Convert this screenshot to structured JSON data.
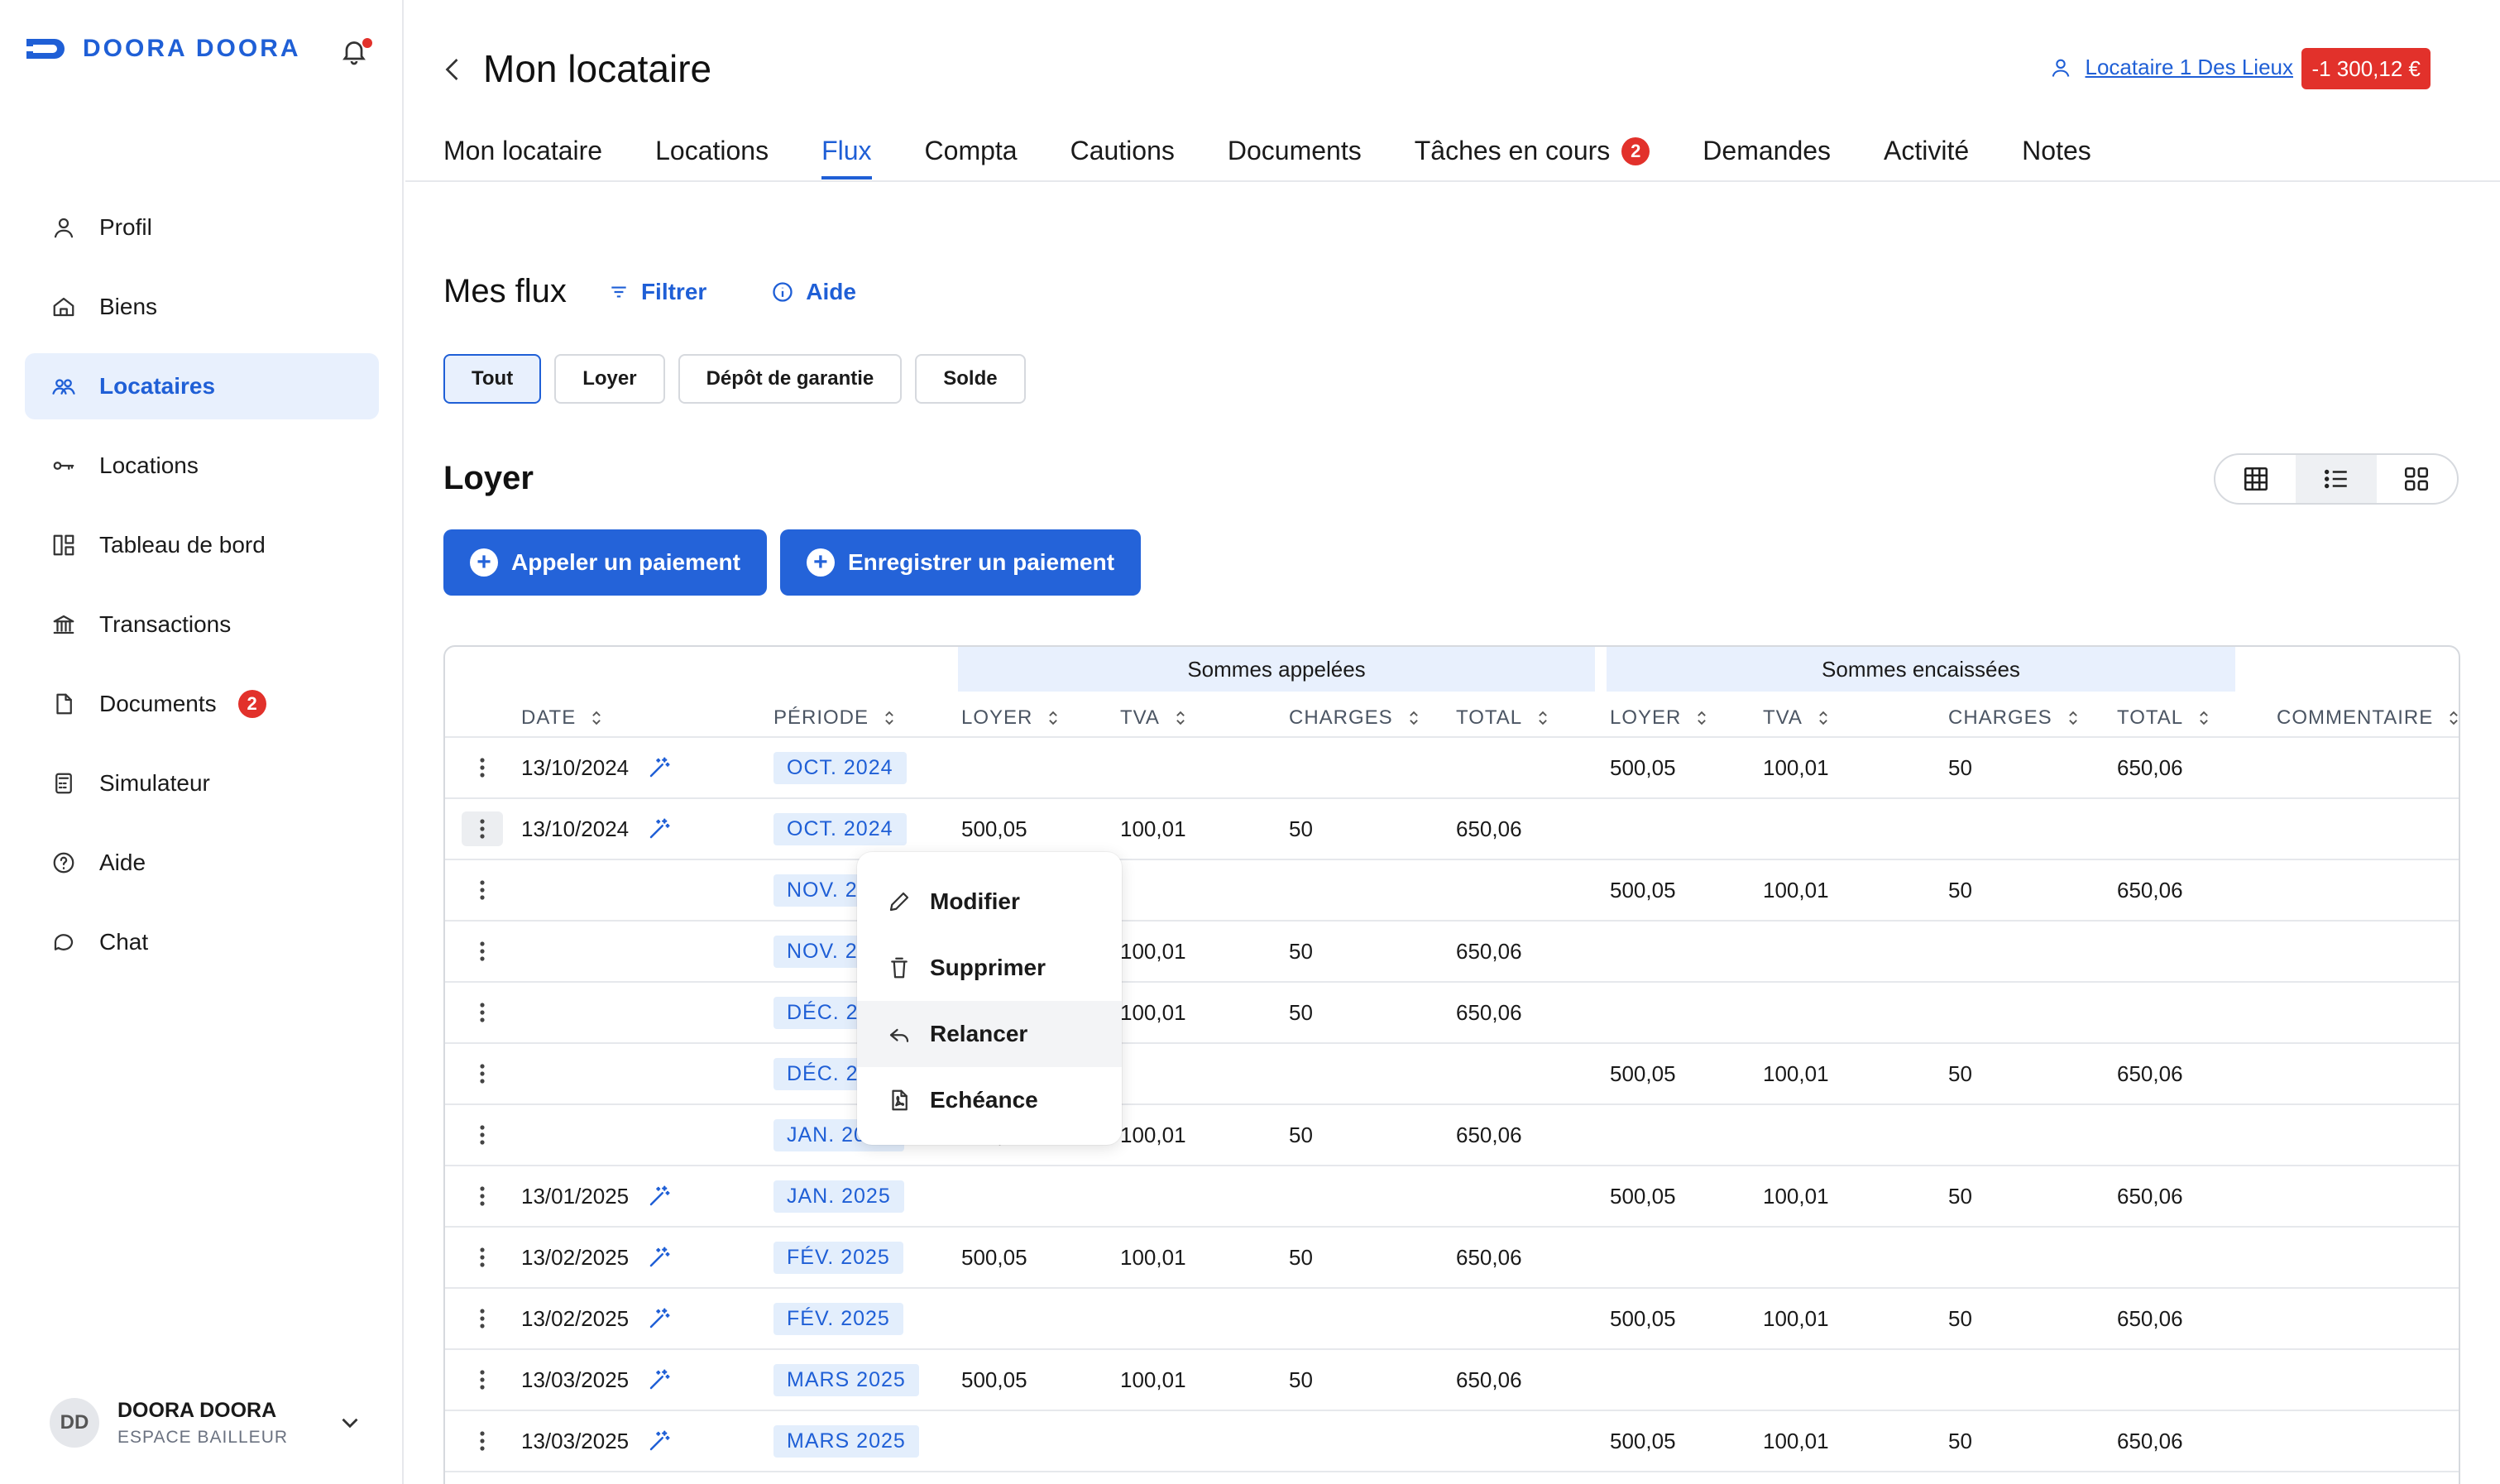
{
  "app": {
    "brand": "DOORA DOORA"
  },
  "sidebar": {
    "items": [
      {
        "label": "Profil",
        "icon": "user-icon"
      },
      {
        "label": "Biens",
        "icon": "home-icon"
      },
      {
        "label": "Locataires",
        "icon": "users-icon",
        "active": true
      },
      {
        "label": "Locations",
        "icon": "key-icon"
      },
      {
        "label": "Tableau de bord",
        "icon": "dashboard-icon"
      },
      {
        "label": "Transactions",
        "icon": "bank-icon"
      },
      {
        "label": "Documents",
        "icon": "document-icon",
        "badge": "2"
      },
      {
        "label": "Simulateur",
        "icon": "calculator-icon"
      },
      {
        "label": "Aide",
        "icon": "help-icon"
      },
      {
        "label": "Chat",
        "icon": "chat-icon"
      }
    ],
    "user": {
      "initials": "DD",
      "name": "DOORA DOORA",
      "role": "ESPACE BAILLEUR"
    }
  },
  "header": {
    "title": "Mon locataire",
    "tenant_link": "Locataire 1 Des Lieux",
    "balance": "-1 300,12 €"
  },
  "tabs": [
    {
      "label": "Mon locataire"
    },
    {
      "label": "Locations"
    },
    {
      "label": "Flux",
      "active": true
    },
    {
      "label": "Compta"
    },
    {
      "label": "Cautions"
    },
    {
      "label": "Documents"
    },
    {
      "label": "Tâches en cours",
      "badge": "2"
    },
    {
      "label": "Demandes"
    },
    {
      "label": "Activité"
    },
    {
      "label": "Notes"
    }
  ],
  "flux": {
    "title": "Mes flux",
    "filter_label": "Filtrer",
    "help_label": "Aide",
    "chips": [
      "Tout",
      "Loyer",
      "Dépôt de garantie",
      "Solde"
    ],
    "active_chip": "Tout"
  },
  "loyer": {
    "title": "Loyer",
    "call_payment": "Appeler un paiement",
    "record_payment": "Enregistrer un paiement",
    "view_mode": "list"
  },
  "table": {
    "group_called": "Sommes appelées",
    "group_collected": "Sommes encaissées",
    "headers": {
      "date": "DATE",
      "periode": "PÉRIODE",
      "c_loyer": "LOYER",
      "c_tva": "TVA",
      "c_charges": "CHARGES",
      "c_total": "TOTAL",
      "e_loyer": "LOYER",
      "e_tva": "TVA",
      "e_charges": "CHARGES",
      "e_total": "TOTAL",
      "commentaire": "COMMENTAIRE"
    },
    "rows": [
      {
        "date": "13/10/2024",
        "periode": "OCT. 2024",
        "type": "encaisse",
        "loyer": "500,05",
        "tva": "100,01",
        "charges": "50",
        "total": "650,06"
      },
      {
        "date": "13/10/2024",
        "periode": "OCT. 2024",
        "type": "appel",
        "loyer": "500,05",
        "tva": "100,01",
        "charges": "50",
        "total": "650,06"
      },
      {
        "date": "",
        "periode": "NOV. 2024",
        "type": "encaisse",
        "loyer": "500,05",
        "tva": "100,01",
        "charges": "50",
        "total": "650,06"
      },
      {
        "date": "",
        "periode": "NOV. 2024",
        "type": "appel",
        "loyer": "500,05",
        "tva": "100,01",
        "charges": "50",
        "total": "650,06"
      },
      {
        "date": "",
        "periode": "DÉC. 2024",
        "type": "appel",
        "loyer": "500,05",
        "tva": "100,01",
        "charges": "50",
        "total": "650,06"
      },
      {
        "date": "",
        "periode": "DÉC. 2024",
        "type": "encaisse",
        "loyer": "500,05",
        "tva": "100,01",
        "charges": "50",
        "total": "650,06"
      },
      {
        "date": "",
        "periode": "JAN. 2025",
        "type": "appel",
        "loyer": "500,05",
        "tva": "100,01",
        "charges": "50",
        "total": "650,06"
      },
      {
        "date": "13/01/2025",
        "periode": "JAN. 2025",
        "type": "encaisse",
        "loyer": "500,05",
        "tva": "100,01",
        "charges": "50",
        "total": "650,06"
      },
      {
        "date": "13/02/2025",
        "periode": "FÉV. 2025",
        "type": "appel",
        "loyer": "500,05",
        "tva": "100,01",
        "charges": "50",
        "total": "650,06"
      },
      {
        "date": "13/02/2025",
        "periode": "FÉV. 2025",
        "type": "encaisse",
        "loyer": "500,05",
        "tva": "100,01",
        "charges": "50",
        "total": "650,06"
      },
      {
        "date": "13/03/2025",
        "periode": "MARS 2025",
        "type": "appel",
        "loyer": "500,05",
        "tva": "100,01",
        "charges": "50",
        "total": "650,06"
      },
      {
        "date": "13/03/2025",
        "periode": "MARS 2025",
        "type": "encaisse",
        "loyer": "500,05",
        "tva": "100,01",
        "charges": "50",
        "total": "650,06"
      }
    ]
  },
  "context_menu": {
    "items": [
      {
        "label": "Modifier",
        "icon": "pencil-icon"
      },
      {
        "label": "Supprimer",
        "icon": "trash-icon"
      },
      {
        "label": "Relancer",
        "icon": "reply-icon"
      },
      {
        "label": "Echéance",
        "icon": "pdf-icon"
      }
    ]
  },
  "colors": {
    "accent": "#1f5fd6",
    "danger": "#e2312b",
    "highlight": "#e8f0fd"
  }
}
